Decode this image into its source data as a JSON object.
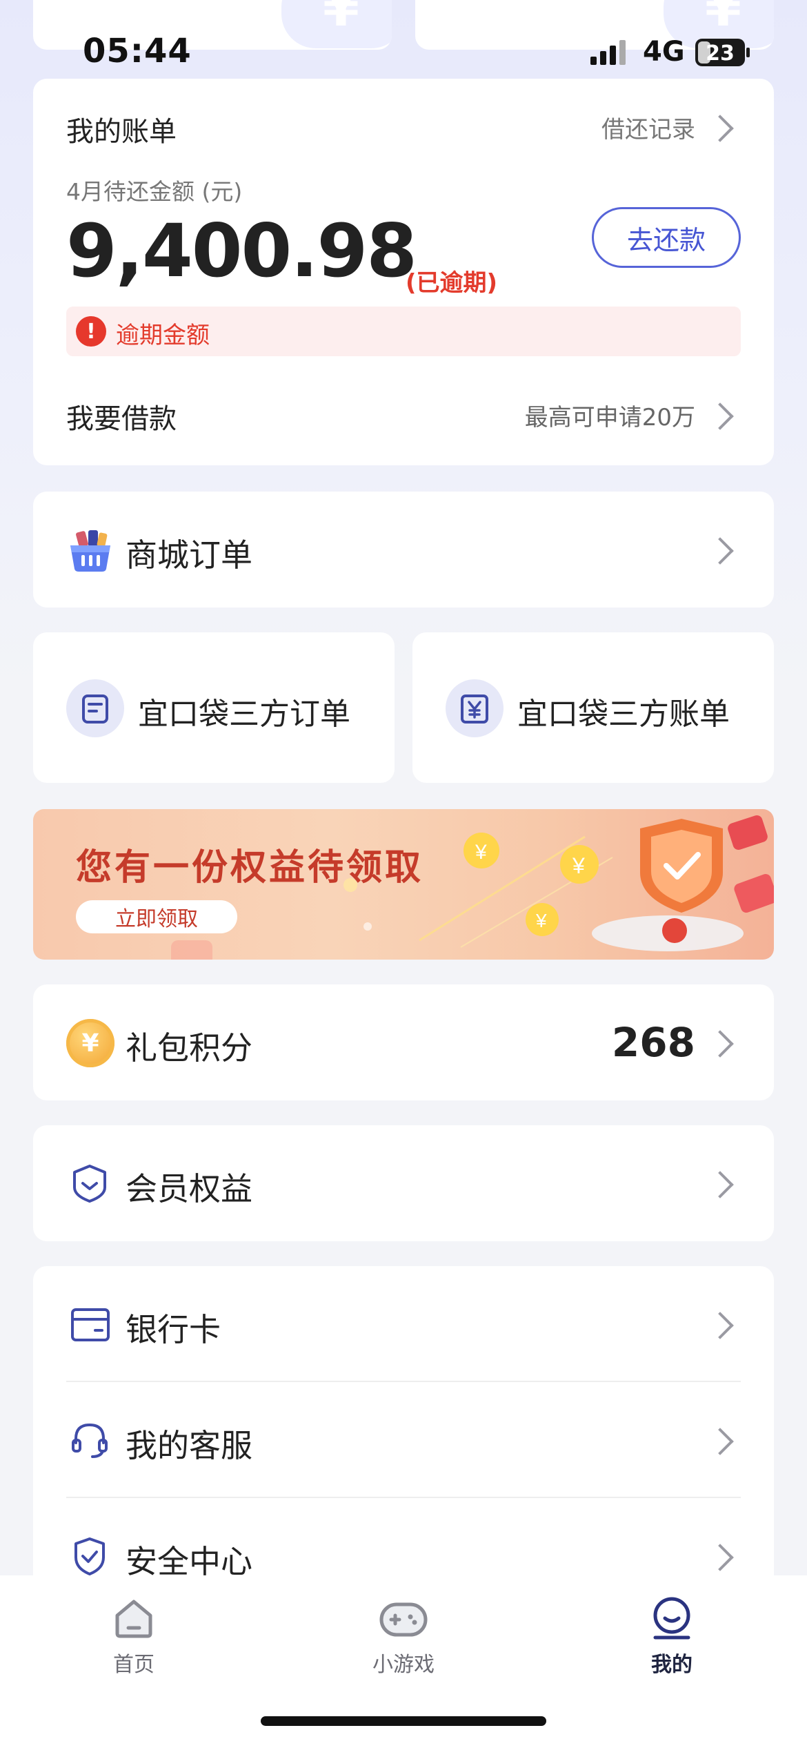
{
  "status_bar": {
    "time": "05:44",
    "network": "4G",
    "battery": "23"
  },
  "bill": {
    "title": "我的账单",
    "link": "借还记录",
    "subtitle": "4月待还金额 (元)",
    "amount": "9,400.98",
    "overdue_tag": "(已逾期)",
    "repay_button": "去还款",
    "warning": "逾期金额",
    "borrow_title": "我要借款",
    "borrow_link": "最高可申请20万"
  },
  "mall_order": {
    "label": "商城订单"
  },
  "third_party": {
    "order": "宜口袋三方订单",
    "bill": "宜口袋三方账单"
  },
  "banner": {
    "title": "您有一份权益待领取",
    "button": "立即领取"
  },
  "points": {
    "label": "礼包积分",
    "value": "268"
  },
  "membership": {
    "label": "会员权益"
  },
  "list": [
    {
      "label": "银行卡",
      "icon": "bank-card-icon"
    },
    {
      "label": "我的客服",
      "icon": "headset-icon"
    },
    {
      "label": "安全中心",
      "icon": "shield-check-icon"
    }
  ],
  "tabs": [
    {
      "label": "首页",
      "icon": "home-icon",
      "active": false
    },
    {
      "label": "小游戏",
      "icon": "gamepad-icon",
      "active": false
    },
    {
      "label": "我的",
      "icon": "profile-icon",
      "active": true
    }
  ],
  "colors": {
    "accent": "#4655d3",
    "danger": "#e33b2c",
    "icon_blue": "#3f4ba8"
  }
}
